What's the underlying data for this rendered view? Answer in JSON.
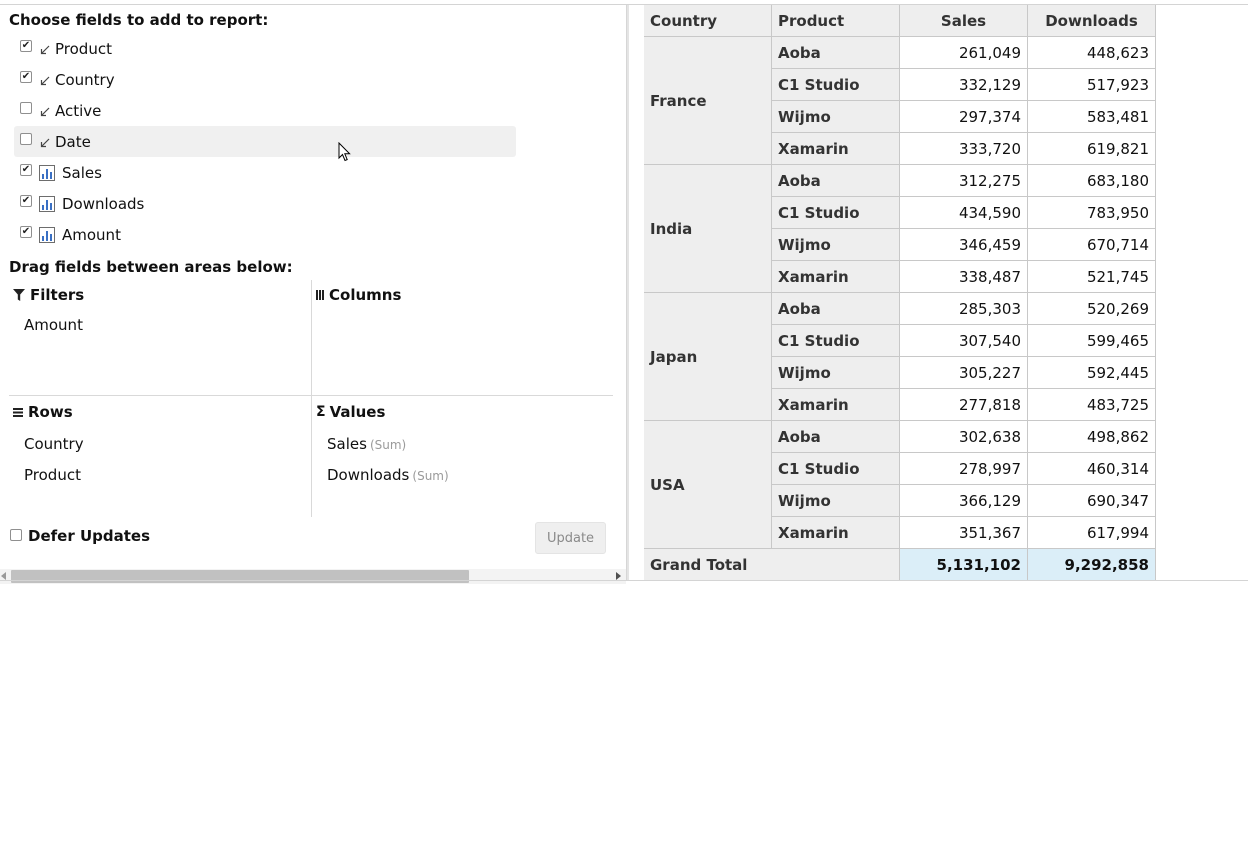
{
  "panel": {
    "fields_title": "Choose fields to add to report:",
    "fields": [
      {
        "label": "Product",
        "checked": true,
        "kind": "dimension"
      },
      {
        "label": "Country",
        "checked": true,
        "kind": "dimension"
      },
      {
        "label": "Active",
        "checked": false,
        "kind": "dimension"
      },
      {
        "label": "Date",
        "checked": false,
        "kind": "dimension"
      },
      {
        "label": "Sales",
        "checked": true,
        "kind": "measure"
      },
      {
        "label": "Downloads",
        "checked": true,
        "kind": "measure"
      },
      {
        "label": "Amount",
        "checked": true,
        "kind": "measure"
      }
    ],
    "drag_title": "Drag fields between areas below:",
    "areas": {
      "filters": {
        "label": "Filters",
        "icon": "filter-icon",
        "fields": [
          "Amount"
        ]
      },
      "columns": {
        "label": "Columns",
        "icon": "columns-icon",
        "fields": []
      },
      "rows": {
        "label": "Rows",
        "icon": "rows-icon",
        "fields": [
          "Country",
          "Product"
        ]
      },
      "values": {
        "label": "Values",
        "icon": "sigma-icon",
        "fields": [
          {
            "name": "Sales",
            "agg": "(Sum)"
          },
          {
            "name": "Downloads",
            "agg": "(Sum)"
          }
        ]
      }
    },
    "defer_label": "Defer Updates",
    "update_label": "Update"
  },
  "grid": {
    "headers": [
      "Country",
      "Product",
      "Sales",
      "Downloads"
    ],
    "groups": [
      {
        "country": "France",
        "rows": [
          {
            "product": "Aoba",
            "sales": "261,049",
            "downloads": "448,623"
          },
          {
            "product": "C1 Studio",
            "sales": "332,129",
            "downloads": "517,923"
          },
          {
            "product": "Wijmo",
            "sales": "297,374",
            "downloads": "583,481"
          },
          {
            "product": "Xamarin",
            "sales": "333,720",
            "downloads": "619,821"
          }
        ]
      },
      {
        "country": "India",
        "rows": [
          {
            "product": "Aoba",
            "sales": "312,275",
            "downloads": "683,180"
          },
          {
            "product": "C1 Studio",
            "sales": "434,590",
            "downloads": "783,950"
          },
          {
            "product": "Wijmo",
            "sales": "346,459",
            "downloads": "670,714"
          },
          {
            "product": "Xamarin",
            "sales": "338,487",
            "downloads": "521,745"
          }
        ]
      },
      {
        "country": "Japan",
        "rows": [
          {
            "product": "Aoba",
            "sales": "285,303",
            "downloads": "520,269"
          },
          {
            "product": "C1 Studio",
            "sales": "307,540",
            "downloads": "599,465"
          },
          {
            "product": "Wijmo",
            "sales": "305,227",
            "downloads": "592,445"
          },
          {
            "product": "Xamarin",
            "sales": "277,818",
            "downloads": "483,725"
          }
        ]
      },
      {
        "country": "USA",
        "rows": [
          {
            "product": "Aoba",
            "sales": "302,638",
            "downloads": "498,862"
          },
          {
            "product": "C1 Studio",
            "sales": "278,997",
            "downloads": "460,314"
          },
          {
            "product": "Wijmo",
            "sales": "366,129",
            "downloads": "690,347"
          },
          {
            "product": "Xamarin",
            "sales": "351,367",
            "downloads": "617,994"
          }
        ]
      }
    ],
    "grand_total": {
      "label": "Grand Total",
      "sales": "5,131,102",
      "downloads": "9,292,858"
    }
  },
  "colors": {
    "accent_total": "#dbeef8",
    "header_bg": "#eeeeee",
    "hover_bg": "#f0f0f0"
  }
}
